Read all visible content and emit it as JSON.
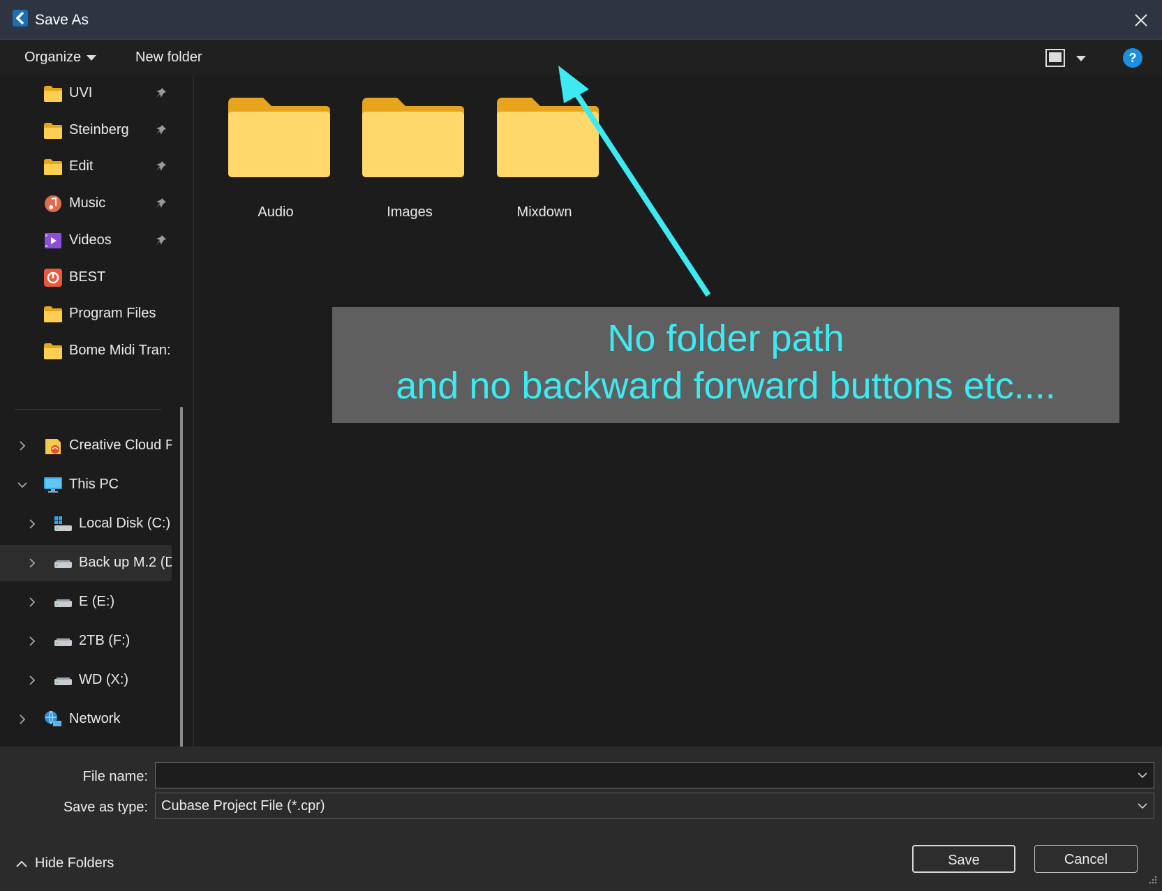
{
  "window": {
    "title": "Save As",
    "close_icon": "close-icon"
  },
  "toolbar": {
    "organize_label": "Organize",
    "new_folder_label": "New folder",
    "view_icon": "view-icon",
    "help_icon": "help-icon",
    "help_glyph": "?"
  },
  "sidebar": {
    "quick_access": [
      {
        "label": "UVI",
        "icon": "folder-icon",
        "pinned": true
      },
      {
        "label": "Steinberg",
        "icon": "folder-icon",
        "pinned": true
      },
      {
        "label": "Edit",
        "icon": "folder-icon",
        "pinned": true
      },
      {
        "label": "Music",
        "icon": "music-icon",
        "pinned": true
      },
      {
        "label": "Videos",
        "icon": "videos-icon",
        "pinned": true
      },
      {
        "label": "BEST",
        "icon": "best-app-icon",
        "pinned": false
      },
      {
        "label": "Program Files",
        "icon": "folder-icon",
        "pinned": false
      },
      {
        "label": "Bome Midi Tran:",
        "icon": "folder-icon",
        "pinned": false
      }
    ],
    "tree": [
      {
        "label": "Creative Cloud F",
        "icon": "creative-cloud-icon",
        "expanded": false
      },
      {
        "label": "This PC",
        "icon": "pc-icon",
        "expanded": true
      },
      {
        "label": "Local Disk (C:)",
        "icon": "windows-drive-icon",
        "expanded": false
      },
      {
        "label": "Back up M.2 (D",
        "icon": "drive-icon",
        "expanded": false,
        "selected": true
      },
      {
        "label": "E (E:)",
        "icon": "drive-icon",
        "expanded": false
      },
      {
        "label": "2TB (F:)",
        "icon": "drive-icon",
        "expanded": false
      },
      {
        "label": "WD (X:)",
        "icon": "drive-icon",
        "expanded": false
      },
      {
        "label": "Network",
        "icon": "network-icon",
        "expanded": false
      }
    ]
  },
  "content": {
    "folders": [
      {
        "label": "Audio"
      },
      {
        "label": "Images"
      },
      {
        "label": "Mixdown"
      }
    ]
  },
  "annotation": {
    "line1": "No folder path",
    "line2": "and no backward forward buttons etc....",
    "color": "#3ee9f2"
  },
  "form": {
    "file_name_label": "File name:",
    "file_name_value": "",
    "save_type_label": "Save as type:",
    "save_type_value": "Cubase Project File (*.cpr)"
  },
  "footer": {
    "hide_folders_label": "Hide Folders",
    "save_label": "Save",
    "cancel_label": "Cancel"
  }
}
